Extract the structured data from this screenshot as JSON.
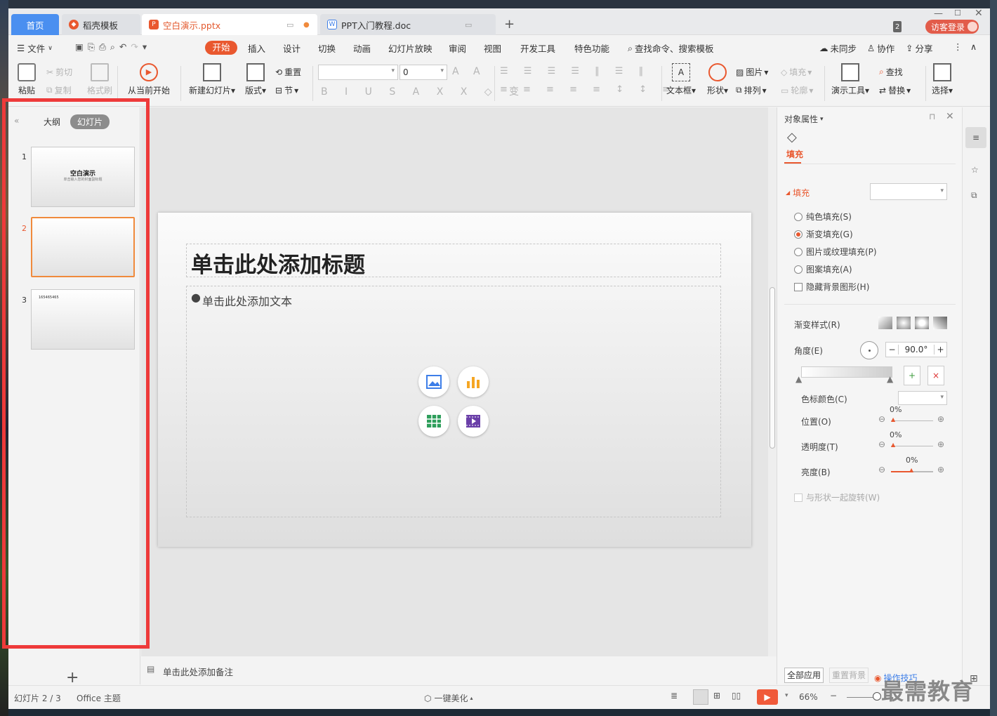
{
  "tabs": {
    "home": "首页",
    "template": "稻壳模板",
    "pptx": "空白演示.pptx",
    "doc": "PPT入门教程.doc",
    "new_tab": "+",
    "badge_count": "2",
    "login": "访客登录"
  },
  "menu": {
    "file": "文件",
    "start": "开始",
    "insert": "插入",
    "design": "设计",
    "transition": "切换",
    "animation": "动画",
    "slideshow": "幻灯片放映",
    "review": "审阅",
    "view": "视图",
    "devtools": "开发工具",
    "features": "特色功能",
    "search": "查找命令、搜索模板",
    "unsync": "未同步",
    "collab": "协作",
    "share": "分享"
  },
  "ribbon": {
    "paste": "粘贴",
    "cut": "剪切",
    "copy": "复制",
    "format_painter": "格式刷",
    "play_from_current": "从当前开始",
    "new_slide": "新建幻灯片",
    "layout": "版式",
    "reset": "重置",
    "section": "节",
    "font_size": "0",
    "textbox": "文本框",
    "shape": "形状",
    "picture": "图片",
    "arrange": "排列",
    "fill": "填充",
    "outline": "轮廓",
    "present_tools": "演示工具",
    "find": "查找",
    "replace": "替换",
    "select": "选择"
  },
  "left_pane": {
    "outline_tab": "大纲",
    "slides_tab": "幻灯片",
    "slides": [
      {
        "num": "1",
        "title": "空白演示",
        "subtitle": "单击输入您的封面副标题"
      },
      {
        "num": "2",
        "title": ""
      },
      {
        "num": "3",
        "title": "165465465"
      }
    ],
    "add": "+"
  },
  "slide": {
    "title_placeholder": "单击此处添加标题",
    "body_placeholder": "单击此处添加文本"
  },
  "notes": {
    "placeholder": "单击此处添加备注"
  },
  "right_pane": {
    "header": "对象属性",
    "fill_tab": "填充",
    "fill_section": "填充",
    "options": [
      "纯色填充(S)",
      "渐变填充(G)",
      "图片或纹理填充(P)",
      "图案填充(A)"
    ],
    "selected_option": "渐变填充(G)",
    "hide_bg": "隐藏背景图形(H)",
    "gradient_style": "渐变样式(R)",
    "angle_label": "角度(E)",
    "angle_value": "90.0°",
    "stop_color": "色标颜色(C)",
    "position": "位置(O)",
    "position_val": "0%",
    "transparency": "透明度(T)",
    "transparency_val": "0%",
    "brightness": "亮度(B)",
    "brightness_val": "0%",
    "rotate_with_shape": "与形状一起旋转(W)",
    "apply_all": "全部应用",
    "reset_bg": "重置背景",
    "tips": "操作技巧"
  },
  "status": {
    "slide_pos": "幻灯片 2 / 3",
    "theme": "Office 主题",
    "beautify": "一键美化",
    "zoom": "66%"
  },
  "watermark": "最需教育",
  "colors": {
    "accent": "#e9582f",
    "home_tab": "#4a8ff0",
    "highlight": "#ee3a3a"
  }
}
